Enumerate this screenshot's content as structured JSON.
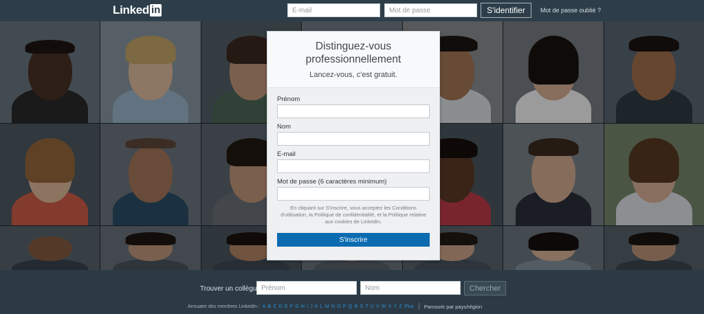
{
  "header": {
    "logo_text": "Linked",
    "logo_in": "in",
    "email_placeholder": "E-mail",
    "password_placeholder": "Mot de passe",
    "signin_label": "S'identifier",
    "forgot_label": "Mot de passe oublié ?"
  },
  "signup": {
    "title": "Distinguez-vous professionnellement",
    "subtitle": "Lancez-vous, c'est gratuit.",
    "fields": [
      {
        "label": "Prénom"
      },
      {
        "label": "Nom"
      },
      {
        "label": "E-mail"
      },
      {
        "label": "Mot de passe (6 caractères minimum)"
      }
    ],
    "terms_text": "En cliquant sur S'inscrire, vous acceptez les Conditions d'utilisation, la Politique de confidentialité, et la Politique relative aux cookies de LinkedIn.",
    "submit_label": "S'inscrire"
  },
  "footer": {
    "find_label": "Trouver un collègue",
    "firstname_placeholder": "Prénom",
    "lastname_placeholder": "Nom",
    "search_label": "Chercher",
    "directory_label": "Annuaire des membres LinkedIn :",
    "letters": [
      "A",
      "B",
      "C",
      "D",
      "E",
      "F",
      "G",
      "H",
      "I",
      "J",
      "K",
      "L",
      "M",
      "N",
      "O",
      "P",
      "Q",
      "R",
      "S",
      "T",
      "U",
      "V",
      "W",
      "X",
      "Y",
      "Z",
      "Plus"
    ],
    "country_link": "Parcourir par pays/région"
  },
  "colors": {
    "topbar": "#2d3e4a",
    "accent_blue": "#0b6bb0",
    "link_blue": "#2f8fd5"
  },
  "icons": [
    "linkedin-logo-icon"
  ]
}
